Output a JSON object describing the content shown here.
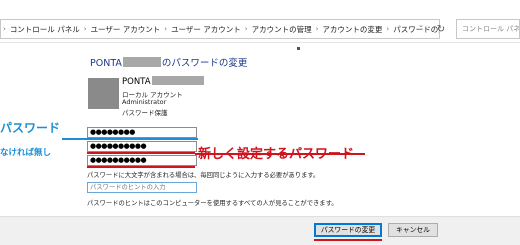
{
  "address_bar": {
    "breadcrumbs": [
      "コントロール パネル",
      "ユーザー アカウント",
      "ユーザー アカウント",
      "アカウントの管理",
      "アカウントの変更",
      "パスワードの変更"
    ],
    "search_placeholder": "コントロール パネルの検索"
  },
  "dialog": {
    "title_prefix": "PONTA",
    "title_suffix": "のパスワードの変更",
    "user": {
      "name": "PONTA",
      "account_type": "ローカル アカウント",
      "role": "Administrator",
      "protection": "パスワード保護"
    },
    "fields": {
      "current_password": "●●●●●●●●",
      "new_password": "●●●●●●●●●●",
      "confirm_password": "●●●●●●●●●●",
      "hint_placeholder": "パスワードのヒントの入力"
    },
    "notes": {
      "case_note": "パスワードに大文字が含まれる場合は、毎回同じように入力する必要があります。",
      "hint_note": "パスワードのヒントはこのコンピューターを使用するすべての人が見ることができます。"
    },
    "buttons": {
      "change": "パスワードの変更",
      "cancel": "キャンセル"
    }
  },
  "annotations": {
    "current_label": "パスワード",
    "current_sub": "なければ無し",
    "new_label": "新しく設定するパスワード",
    "colors": {
      "blue": "#1a8fd6",
      "red": "#d0141e"
    }
  }
}
